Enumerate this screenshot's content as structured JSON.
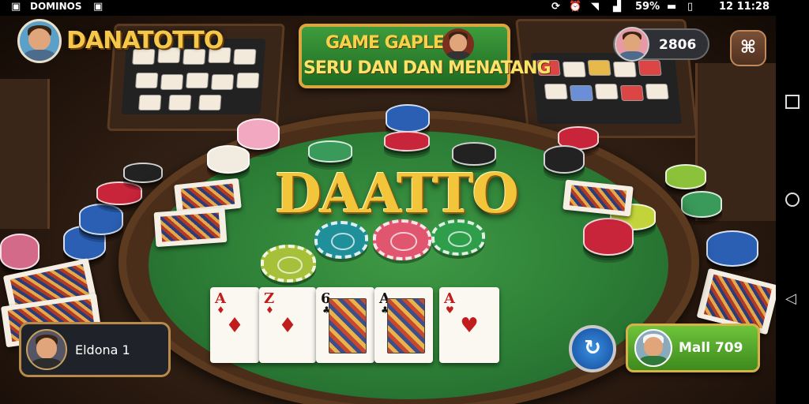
{
  "status_bar": {
    "left_text": "DOMINOS",
    "battery_percent": "59%",
    "time": "12 11:28"
  },
  "header": {
    "game_title": "DANATOTTO",
    "coins": "2806"
  },
  "banner": {
    "line1": "GAME GAPLE",
    "line2": "SERU DAN DAN MENATANG"
  },
  "table": {
    "center_logo": "DAATTO"
  },
  "hand_cards": [
    {
      "rank": "A",
      "suit": "♦",
      "color": "#c21d1d",
      "face": false
    },
    {
      "rank": "Z",
      "suit": "♦",
      "color": "#c21d1d",
      "face": false
    },
    {
      "rank": "6",
      "suit": "♣",
      "color": "#111111",
      "face": true
    },
    {
      "rank": "A",
      "suit": "♣",
      "color": "#111111",
      "face": true
    },
    {
      "rank": "A",
      "suit": "♥",
      "color": "#c21d1d",
      "face": false
    }
  ],
  "player": {
    "name": "Eldona 1"
  },
  "action_button": {
    "label": "Mall 709"
  },
  "colors": {
    "felt": "#2c7d36",
    "gold": "#f3c53b",
    "button_green": "#5fb532"
  }
}
